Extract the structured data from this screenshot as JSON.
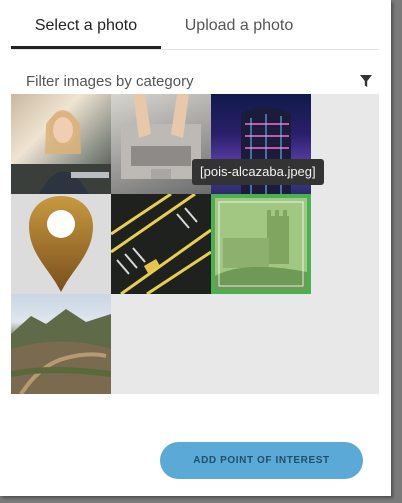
{
  "tabs": [
    {
      "label": "Select a photo",
      "active": true
    },
    {
      "label": "Upload a photo",
      "active": false
    }
  ],
  "filter": {
    "label": "Filter images by category",
    "icon": "filter-icon"
  },
  "gallery": {
    "images": [
      {
        "icon": "photo-woman-laptop"
      },
      {
        "icon": "photo-hands-laptop"
      },
      {
        "icon": "photo-building-night"
      },
      {
        "icon": "location-pin-icon"
      },
      {
        "icon": "photo-car-road-aerial"
      },
      {
        "icon": "photo-castle-alcazaba",
        "selected": true
      },
      {
        "icon": "photo-mountain-landscape"
      }
    ]
  },
  "tooltip": {
    "text": "[pois-alcazaba.jpeg]"
  },
  "cta": {
    "label": "ADD POINT OF INTEREST"
  },
  "colors": {
    "accent": "#5aa9d6",
    "selected_border": "#4caf50",
    "tooltip_bg": "#333333"
  }
}
